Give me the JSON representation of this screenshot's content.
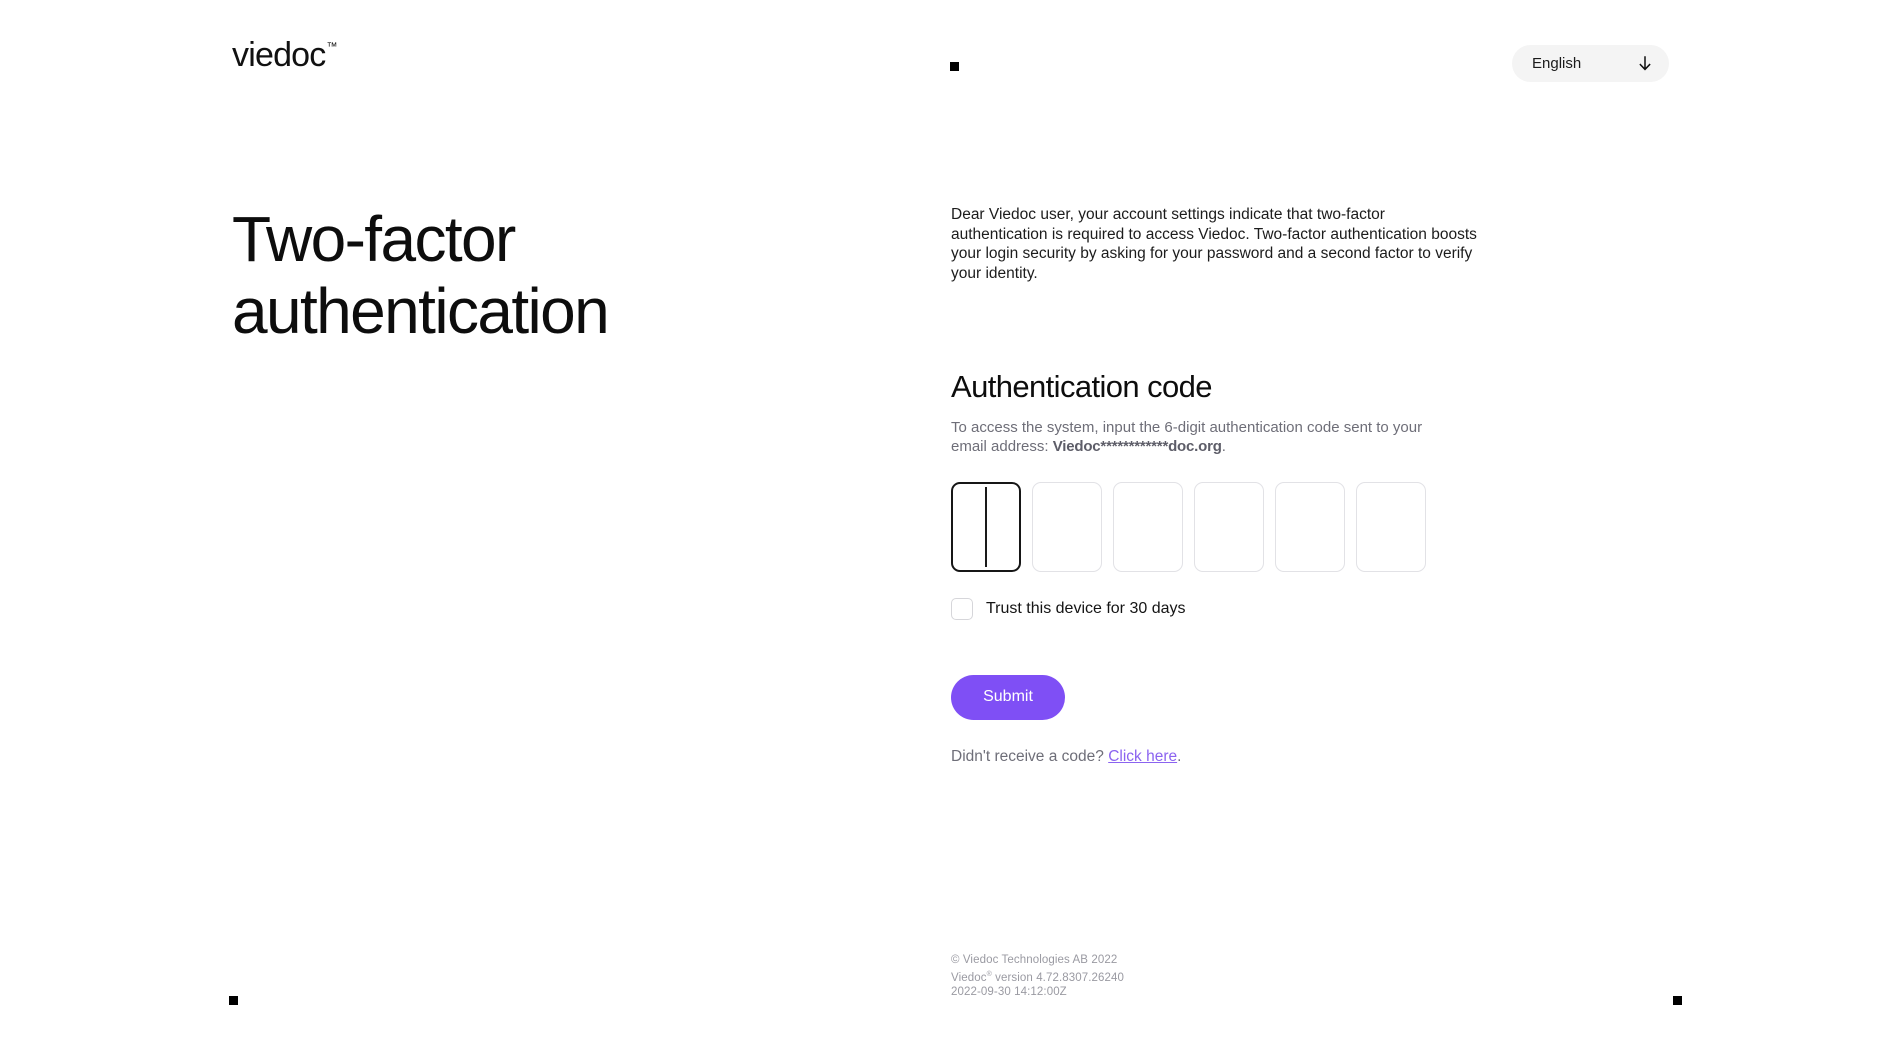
{
  "brand": {
    "logo_text": "viedoc",
    "logo_trademark": "™",
    "accent_color": "#7f4ff5",
    "link_color": "#8b63f0"
  },
  "header": {
    "language_selector": {
      "value": "English",
      "icon": "arrow-down-icon"
    }
  },
  "hero": {
    "title": "Two-factor authentication"
  },
  "intro": {
    "paragraph": "Dear Viedoc user, your account settings indicate that two-factor authentication is required to access Viedoc. Two-factor authentication boosts your login security by asking for your password and a second factor to verify your identity."
  },
  "auth": {
    "section_title": "Authentication code",
    "instruction_prefix": "To access the system, input the 6-digit authentication code sent to your email address: ",
    "masked_email": "Viedoc************doc.org",
    "instruction_suffix": ".",
    "otp": {
      "digit_count": 6,
      "values": [
        "",
        "",
        "",
        "",
        "",
        ""
      ],
      "focused_index": 0
    },
    "trust_device": {
      "label": "Trust this device for 30 days",
      "checked": false
    },
    "submit_label": "Submit",
    "resend_prefix": "Didn't receive a code? ",
    "resend_link": "Click here",
    "resend_suffix": "."
  },
  "footer": {
    "copyright": "© Viedoc Technologies AB 2022",
    "version_prefix": "Viedoc",
    "version_trademark": "®",
    "version_text": " version 4.72.8307.26240",
    "timestamp": "2022-09-30 14:12:00Z"
  }
}
